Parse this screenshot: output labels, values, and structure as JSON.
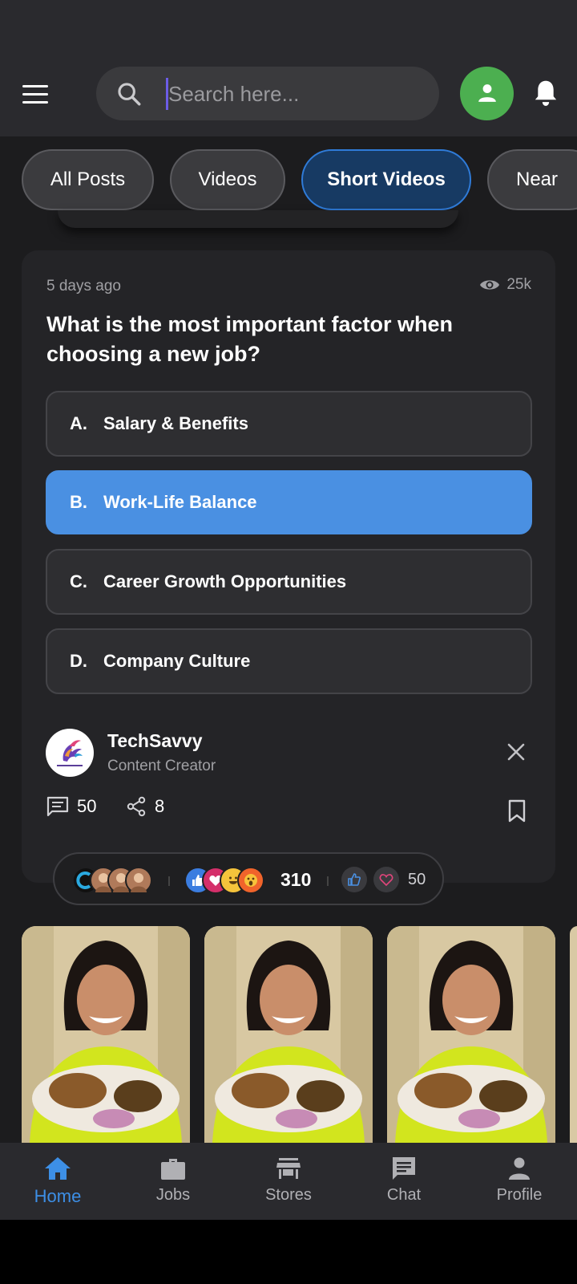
{
  "header": {
    "search_placeholder": "Search here..."
  },
  "filters": [
    {
      "label": "All Posts",
      "active": false
    },
    {
      "label": "Videos",
      "active": false
    },
    {
      "label": "Short Videos",
      "active": true
    },
    {
      "label": "Near",
      "active": false
    }
  ],
  "poll": {
    "time_ago": "5 days ago",
    "views": "25k",
    "question": "What is the most important factor when choosing a new job?",
    "options": [
      {
        "letter": "A.",
        "text": "Salary & Benefits",
        "selected": false
      },
      {
        "letter": "B.",
        "text": "Work-Life Balance",
        "selected": true
      },
      {
        "letter": "C.",
        "text": "Career Growth Opportunities",
        "selected": false
      },
      {
        "letter": "D.",
        "text": "Company Culture",
        "selected": false
      }
    ],
    "author": {
      "name": "TechSavvy",
      "role": "Content Creator"
    },
    "comments": "50",
    "shares": "8"
  },
  "reactions": {
    "total": "310",
    "secondary_count": "50"
  },
  "bottom_nav": [
    {
      "label": "Home",
      "icon": "home-icon",
      "active": true
    },
    {
      "label": "Jobs",
      "icon": "briefcase-icon",
      "active": false
    },
    {
      "label": "Stores",
      "icon": "store-icon",
      "active": false
    },
    {
      "label": "Chat",
      "icon": "chat-icon",
      "active": false
    },
    {
      "label": "Profile",
      "icon": "person-icon",
      "active": false
    }
  ],
  "colors": {
    "accent": "#4a90e2",
    "active_chip_bg": "#173a63",
    "nav_active": "#3d8fe6",
    "avatar_green": "#4caf50"
  }
}
